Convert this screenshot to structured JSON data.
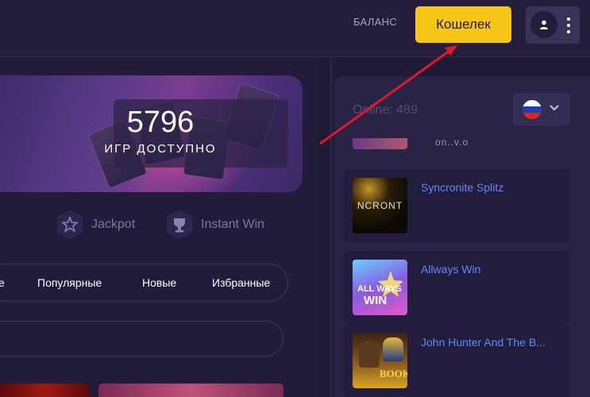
{
  "header": {
    "balance_label": "БАЛАНС",
    "wallet_button": "Кошелек"
  },
  "banner": {
    "count": "5796",
    "label": "ИГР ДОСТУПНО"
  },
  "categories": [
    {
      "label": "Jackpot",
      "icon": "star-icon"
    },
    {
      "label": "Instant Win",
      "icon": "trophy-icon"
    }
  ],
  "tabs": [
    "е",
    "Популярные",
    "Новые",
    "Избранные"
  ],
  "sidebar": {
    "online": "Online: 489",
    "partial_title": "on..v.o",
    "games": [
      {
        "title": "Syncronite Splitz"
      },
      {
        "title": "Allways Win"
      },
      {
        "title": "John Hunter And The B..."
      }
    ]
  },
  "colors": {
    "accent": "#f5c518",
    "link": "#5b8cff",
    "background": "#1f1a35",
    "annotation_arrow": "#e0192a"
  }
}
